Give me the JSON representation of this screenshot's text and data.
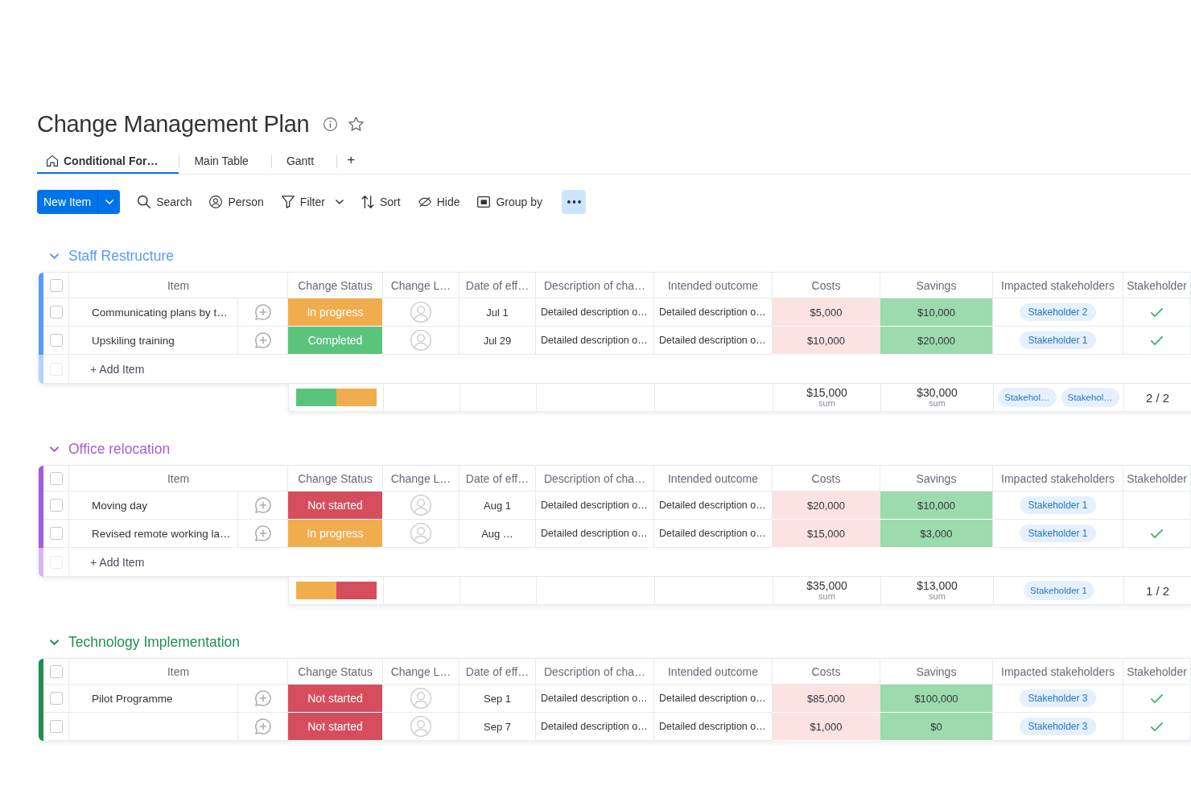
{
  "board": {
    "title": "Change Management Plan"
  },
  "views": {
    "tabs": [
      {
        "label": "Conditional For…",
        "kind": "home",
        "selected": true
      },
      {
        "label": "Main Table",
        "kind": "table",
        "selected": false
      },
      {
        "label": "Gantt",
        "kind": "gantt",
        "selected": false
      }
    ],
    "add": "+"
  },
  "toolbar": {
    "new_item": "New Item",
    "items": [
      {
        "label": "Search",
        "kind": "search",
        "dropdown": false
      },
      {
        "label": "Person",
        "kind": "person",
        "dropdown": false
      },
      {
        "label": "Filter",
        "kind": "filter",
        "dropdown": true
      },
      {
        "label": "Sort",
        "kind": "sort",
        "dropdown": false
      },
      {
        "label": "Hide",
        "kind": "hide",
        "dropdown": false
      },
      {
        "label": "Group by",
        "kind": "group",
        "dropdown": false
      }
    ]
  },
  "groups": [
    {
      "title": "Staff Restructure",
      "color": "#579bfc",
      "expanded": true,
      "all_checked": false,
      "columns": [
        {
          "label": "Item",
          "kind": "item"
        },
        {
          "label": "Change Status",
          "kind": "status"
        },
        {
          "label": "Change L…",
          "kind": "person"
        },
        {
          "label": "Date of eff…",
          "kind": "date"
        },
        {
          "label": "Description of cha…",
          "kind": "text"
        },
        {
          "label": "Intended outcome",
          "kind": "text"
        },
        {
          "label": "Costs",
          "kind": "amount",
          "color": "#fde2e2"
        },
        {
          "label": "Savings",
          "kind": "amount",
          "color": "#9cdbac"
        },
        {
          "label": "Impacted stakeholders",
          "kind": "tags"
        },
        {
          "label": "Stakeholder",
          "kind": "check"
        }
      ],
      "rows": [
        {
          "checked": false,
          "item": "Communicating plans by t…",
          "status": {
            "label": "In progress",
            "color": "#f0ad4e"
          },
          "date": "Jul 1",
          "texts": [
            "Detailed description o…",
            "Detailed description o…"
          ],
          "amounts": [
            "$5,000",
            "$10,000"
          ],
          "stakeholders": [
            "Stakeholder 2"
          ],
          "approved": true
        },
        {
          "checked": false,
          "item": "Upskiling training",
          "status": {
            "label": "Completed",
            "color": "#5ac47d"
          },
          "date": "Jul 29",
          "texts": [
            "Detailed description o…",
            "Detailed description o…"
          ],
          "amounts": [
            "$10,000",
            "$20,000"
          ],
          "stakeholders": [
            "Stakeholder 1"
          ],
          "approved": true
        }
      ],
      "add_item": {
        "placeholder": "+ Add Item",
        "checked": false
      },
      "summary": {
        "status_mix": [
          {
            "color": "#5ac47d",
            "level": 0.5
          },
          {
            "color": "#f0ad4e",
            "level": 0.5
          }
        ],
        "amounts": [
          {
            "value": "$15,000",
            "label": "sum"
          },
          {
            "value": "$30,000",
            "label": "sum"
          }
        ],
        "stakeholders": [
          "Stakehol…",
          "Stakehol…"
        ],
        "approved": "2 / 2"
      }
    },
    {
      "title": "Office relocation",
      "color": "#a25ddc",
      "expanded": true,
      "all_checked": false,
      "columns": [
        {
          "label": "Item",
          "kind": "item"
        },
        {
          "label": "Change Status",
          "kind": "status"
        },
        {
          "label": "Change L…",
          "kind": "person"
        },
        {
          "label": "Date of eff…",
          "kind": "date"
        },
        {
          "label": "Description of cha…",
          "kind": "text"
        },
        {
          "label": "Intended outcome",
          "kind": "text"
        },
        {
          "label": "Costs",
          "kind": "amount",
          "color": "#fde2e2"
        },
        {
          "label": "Savings",
          "kind": "amount",
          "color": "#9cdbac"
        },
        {
          "label": "Impacted stakeholders",
          "kind": "tags"
        },
        {
          "label": "Stakeholder",
          "kind": "check"
        }
      ],
      "rows": [
        {
          "checked": false,
          "item": "Moving day",
          "status": {
            "label": "Not started",
            "color": "#d64e5d"
          },
          "date": "Aug 1",
          "texts": [
            "Detailed description o…",
            "Detailed description o…"
          ],
          "amounts": [
            "$20,000",
            "$10,000"
          ],
          "stakeholders": [
            "Stakeholder 1"
          ],
          "approved": false
        },
        {
          "checked": false,
          "item": "Revised remote working la…",
          "status": {
            "label": "In progress",
            "color": "#f0ad4e"
          },
          "date": "Aug …",
          "texts": [
            "Detailed description o…",
            "Detailed description o…"
          ],
          "amounts": [
            "$15,000",
            "$3,000"
          ],
          "stakeholders": [
            "Stakeholder 1"
          ],
          "approved": true
        }
      ],
      "add_item": {
        "placeholder": "+ Add Item",
        "checked": false
      },
      "summary": {
        "status_mix": [
          {
            "color": "#f0ad4e",
            "level": 0.5
          },
          {
            "color": "#d64e5d",
            "level": 0.5
          }
        ],
        "amounts": [
          {
            "value": "$35,000",
            "label": "sum"
          },
          {
            "value": "$13,000",
            "label": "sum"
          }
        ],
        "stakeholders": [
          "Stakeholder 1"
        ],
        "approved": "1 / 2"
      }
    },
    {
      "title": "Technology Implementation",
      "color": "#1f8f4e",
      "expanded": true,
      "all_checked": false,
      "columns": [
        {
          "label": "Item",
          "kind": "item"
        },
        {
          "label": "Change Status",
          "kind": "status"
        },
        {
          "label": "Change L…",
          "kind": "person"
        },
        {
          "label": "Date of eff…",
          "kind": "date"
        },
        {
          "label": "Description of cha…",
          "kind": "text"
        },
        {
          "label": "Intended outcome",
          "kind": "text"
        },
        {
          "label": "Costs",
          "kind": "amount",
          "color": "#fde2e2"
        },
        {
          "label": "Savings",
          "kind": "amount",
          "color": "#9cdbac"
        },
        {
          "label": "Impacted stakeholders",
          "kind": "tags"
        },
        {
          "label": "Stakeholder",
          "kind": "check"
        }
      ],
      "rows": [
        {
          "checked": false,
          "item": "Pilot Programme",
          "status": {
            "label": "Not started",
            "color": "#d64e5d"
          },
          "date": "Sep 1",
          "texts": [
            "Detailed description o…",
            "Detailed description o…"
          ],
          "amounts": [
            "$85,000",
            "$100,000"
          ],
          "stakeholders": [
            "Stakeholder 3"
          ],
          "approved": true
        },
        {
          "checked": false,
          "status": {
            "label": "Not started",
            "color": "#d64e5d"
          },
          "date": "Sep 7",
          "texts": [
            "Detailed description o…",
            "Detailed description o…"
          ],
          "amounts": [
            "$1,000",
            "$0"
          ],
          "stakeholders": [
            "Stakeholder 3"
          ],
          "approved": true
        }
      ]
    }
  ]
}
